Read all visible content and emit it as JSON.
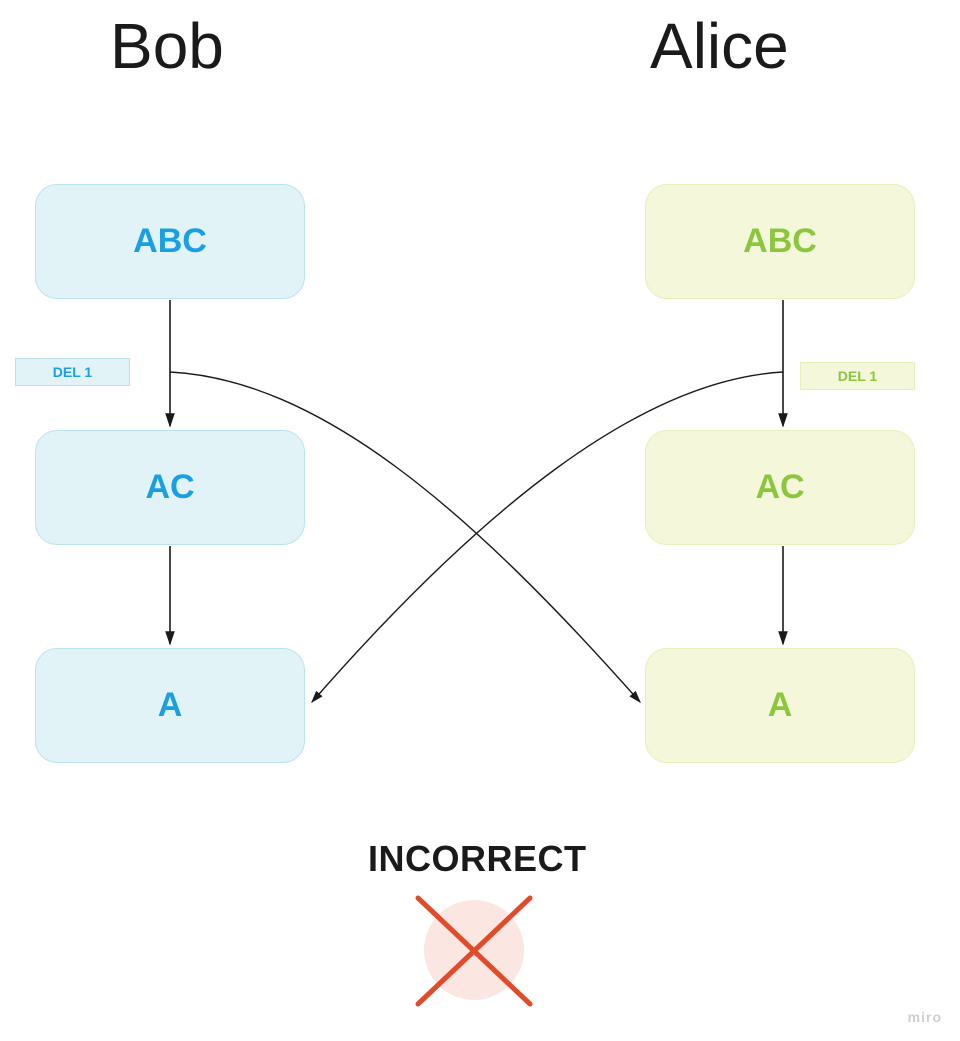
{
  "titles": {
    "left": "Bob",
    "right": "Alice"
  },
  "bob": {
    "states": [
      "ABC",
      "AC",
      "A"
    ],
    "op_label": "DEL 1"
  },
  "alice": {
    "states": [
      "ABC",
      "AC",
      "A"
    ],
    "op_label": "DEL 1"
  },
  "banner": "INCORRECT",
  "watermark": "miro",
  "chart_data": {
    "type": "flow",
    "description": "Two parallel state sequences (Bob and Alice) each applying operation DEL 1 to string state, converging via cross-applied operations to final states; result marked incorrect.",
    "actors": [
      "Bob",
      "Alice"
    ],
    "sequences": {
      "Bob": [
        "ABC",
        "AC",
        "A"
      ],
      "Alice": [
        "ABC",
        "AC",
        "A"
      ]
    },
    "operations": [
      {
        "actor": "Bob",
        "label": "DEL 1",
        "from": "ABC",
        "to": "AC"
      },
      {
        "actor": "Alice",
        "label": "DEL 1",
        "from": "ABC",
        "to": "AC"
      }
    ],
    "cross_edges": [
      {
        "from_actor": "Bob",
        "from_state_index": 0,
        "to_actor": "Alice",
        "to_state_index": 2
      },
      {
        "from_actor": "Alice",
        "from_state_index": 0,
        "to_actor": "Bob",
        "to_state_index": 2
      }
    ],
    "result": "INCORRECT"
  }
}
